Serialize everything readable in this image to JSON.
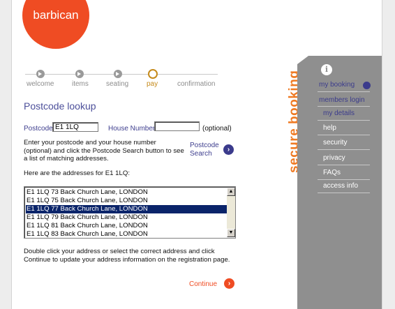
{
  "brand": {
    "logo_text": "barbican",
    "accent": "#ef4c23"
  },
  "steps": [
    {
      "label": "welcome",
      "state": "done"
    },
    {
      "label": "items",
      "state": "done"
    },
    {
      "label": "seating",
      "state": "done"
    },
    {
      "label": "pay",
      "state": "current"
    },
    {
      "label": "confirmation",
      "state": "todo"
    }
  ],
  "form": {
    "title": "Postcode lookup",
    "postcode_label": "Postcode",
    "postcode_value": "E1 1LQ",
    "house_label": "House Number",
    "house_value": "",
    "optional_label": "(optional)",
    "instructions": "Enter your postcode and your house number (optional) and click the Postcode Search button to see a list of matching addresses.",
    "search_label": "Postcode Search",
    "results_heading": "Here are the addresses for E1 1LQ:",
    "addresses": [
      "E1 1LQ 73 Back Church Lane, LONDON",
      "E1 1LQ 75 Back Church Lane, LONDON",
      "E1 1LQ 77 Back Church Lane, LONDON",
      "E1 1LQ 79 Back Church Lane, LONDON",
      "E1 1LQ 81 Back Church Lane, LONDON",
      "E1 1LQ 83 Back Church Lane, LONDON"
    ],
    "selected_address_index": 2,
    "help_text": "Double click your address or select the correct address and click Continue to update your address information on the registration page.",
    "continue_label": "Continue"
  },
  "sidebar": {
    "heading": "secure booking",
    "items": [
      {
        "label": "my booking",
        "style": "blue"
      },
      {
        "label": "members login",
        "style": "blue"
      },
      {
        "label": "my details",
        "style": "blue"
      },
      {
        "label": "help",
        "style": "white"
      },
      {
        "label": "security",
        "style": "white"
      },
      {
        "label": "privacy",
        "style": "white"
      },
      {
        "label": "FAQs",
        "style": "white"
      },
      {
        "label": "access info",
        "style": "white"
      }
    ]
  },
  "colors": {
    "nav_blue": "#3b3b8c",
    "panel_gray": "#8f8f8f",
    "step_active": "#c58a1b",
    "selection": "#0a246a"
  }
}
